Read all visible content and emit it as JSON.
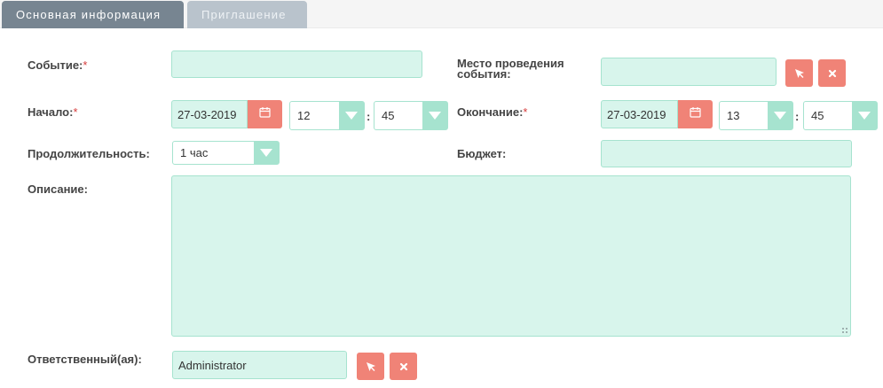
{
  "tabs": [
    {
      "label": "Основная информация"
    },
    {
      "label": "Приглашение"
    }
  ],
  "form": {
    "event": {
      "label": "Событие:",
      "required_mark": "*",
      "value": ""
    },
    "location": {
      "label": "Место проведения события:",
      "value": ""
    },
    "start": {
      "label": "Начало:",
      "required_mark": "*",
      "date": "27-03-2019",
      "hour": "12",
      "minute": "45"
    },
    "end": {
      "label": "Окончание:",
      "required_mark": "*",
      "date": "27-03-2019",
      "hour": "13",
      "minute": "45"
    },
    "duration": {
      "label": "Продолжительность:",
      "value": "1 час"
    },
    "budget": {
      "label": "Бюджет:",
      "value": ""
    },
    "description": {
      "label": "Описание:",
      "value": ""
    },
    "assigned": {
      "label": "Ответственный(ая):",
      "value": "Administrator"
    },
    "time_separator": ":"
  },
  "colors": {
    "accent": "#a6e3cf",
    "field_bg": "#d8f5ec",
    "button_red": "#f08377",
    "tab_active": "#778591",
    "tab_inactive": "#b9c3cc",
    "required": "#d63c3c"
  },
  "icons": {
    "select": "cursor-arrow-icon",
    "clear": "close-x-icon",
    "calendar": "calendar-icon"
  }
}
